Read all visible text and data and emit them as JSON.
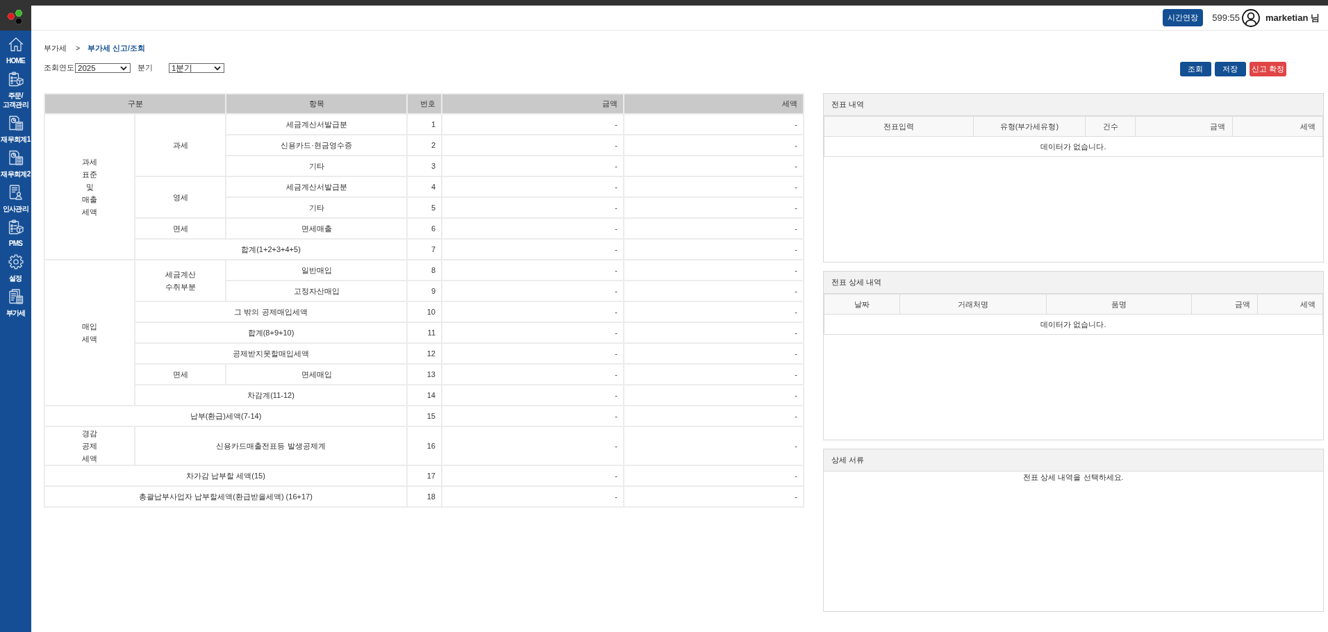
{
  "sidebar": {
    "items": [
      {
        "label": "HOME",
        "kind": "home"
      },
      {
        "label": "주문/\n고객관리",
        "kind": "orders"
      },
      {
        "label": "재무회계1",
        "kind": "finance"
      },
      {
        "label": "재무회계2",
        "kind": "finance"
      },
      {
        "label": "인사관리",
        "kind": "hr"
      },
      {
        "label": "PMS",
        "kind": "pms"
      },
      {
        "label": "설정",
        "kind": "settings"
      },
      {
        "label": "부가세",
        "kind": "vat"
      }
    ]
  },
  "header": {
    "extend_button": "시간연장",
    "timer": "599:55",
    "user": "marketian 님"
  },
  "breadcrumb": {
    "separator": ">",
    "items": [
      {
        "label": "부가세",
        "current": false
      },
      {
        "label": "부가세 신고/조회",
        "current": true
      }
    ]
  },
  "filters": [
    {
      "label": "조회연도",
      "value": "2025"
    },
    {
      "label": "분기",
      "value": "1분기"
    }
  ],
  "actions": [
    {
      "label": "조회",
      "kind": "primary"
    },
    {
      "label": "저장",
      "kind": "primary"
    },
    {
      "label": "신고 확정",
      "kind": "danger"
    }
  ],
  "tax_table": {
    "columns": [
      {
        "label": "구분"
      },
      {
        "label": "항목"
      },
      {
        "label": "번호"
      },
      {
        "label": "금액"
      },
      {
        "label": "세액"
      }
    ],
    "sections": [
      {
        "label": "과세\n표준\n및\n매출\n세액",
        "groups": [
          {
            "label": "과세",
            "lines": [
              {
                "item": "세금계산서발급분",
                "no": "1",
                "amount": "-",
                "tax": "-"
              },
              {
                "item": "신용카드·현금영수증",
                "no": "2",
                "amount": "-",
                "tax": "-"
              },
              {
                "item": "기타",
                "no": "3",
                "amount": "-",
                "tax": "-"
              }
            ]
          },
          {
            "label": "영세",
            "lines": [
              {
                "item": "세금계산서발급분",
                "no": "4",
                "amount": "-",
                "tax": "-"
              },
              {
                "item": "기타",
                "no": "5",
                "amount": "-",
                "tax": "-"
              }
            ]
          },
          {
            "label": "면세",
            "lines": [
              {
                "item": "면세매출",
                "no": "6",
                "amount": "-",
                "tax": "-"
              }
            ]
          },
          {
            "lines": [
              {
                "item": "합계(1+2+3+4+5)",
                "no": "7",
                "amount": "-",
                "tax": "-"
              }
            ]
          }
        ]
      },
      {
        "label": "매입\n세액",
        "groups": [
          {
            "label": "세금계산\n수취부분",
            "lines": [
              {
                "item": "일반매입",
                "no": "8",
                "amount": "-",
                "tax": "-"
              },
              {
                "item": "고정자산매입",
                "no": "9",
                "amount": "-",
                "tax": "-"
              }
            ]
          },
          {
            "lines": [
              {
                "item": "그 밖의 공제매입세액",
                "no": "10",
                "amount": "-",
                "tax": "-"
              },
              {
                "item": "합계(8+9+10)",
                "no": "11",
                "amount": "-",
                "tax": "-"
              },
              {
                "item": "공제받지못할매입세액",
                "no": "12",
                "amount": "-",
                "tax": "-"
              }
            ]
          },
          {
            "label": "면세",
            "lines": [
              {
                "item": "면세매입",
                "no": "13",
                "amount": "-",
                "tax": "-"
              }
            ]
          },
          {
            "lines": [
              {
                "item": "차감계(11-12)",
                "no": "14",
                "amount": "-",
                "tax": "-"
              }
            ]
          }
        ]
      },
      {
        "groups": [
          {
            "lines": [
              {
                "item": "납부(환급)세액(7-14)",
                "no": "15",
                "amount": "-",
                "tax": "-"
              }
            ]
          }
        ]
      },
      {
        "label": "경감\n공제\n세액",
        "groups": [
          {
            "lines": [
              {
                "item": "신용카드매출전표등 발생공제계",
                "no": "16",
                "amount": "-",
                "tax": "-"
              }
            ]
          }
        ]
      },
      {
        "groups": [
          {
            "lines": [
              {
                "item": "차가감 납부할 세액(15)",
                "no": "17",
                "amount": "-",
                "tax": "-"
              }
            ]
          }
        ]
      },
      {
        "groups": [
          {
            "lines": [
              {
                "item": "총괄납부사업자 납부할세액(환급받을세액) (16+17)",
                "no": "18",
                "amount": "-",
                "tax": "-"
              }
            ]
          }
        ]
      }
    ]
  },
  "panels": [
    {
      "title": "전표 내역",
      "kind": "table",
      "columns": [
        "전표입력",
        "유형(부가세유형)",
        "건수",
        "금액",
        "세액"
      ],
      "empty_text": "데이터가 없습니다."
    },
    {
      "title": "전표 상세 내역",
      "kind": "table",
      "columns": [
        "날짜",
        "거래처명",
        "품명",
        "금액",
        "세액"
      ],
      "empty_text": "데이터가 없습니다."
    },
    {
      "title": "상세 서류",
      "kind": "message",
      "message": "전표 상세 내역을 선택하세요."
    }
  ]
}
